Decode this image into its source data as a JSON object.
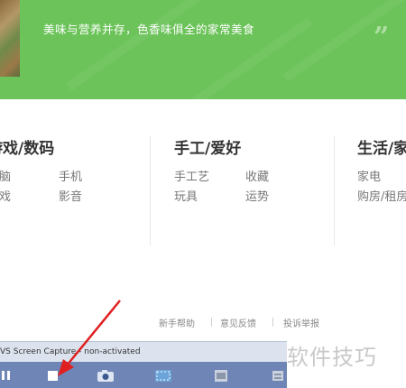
{
  "banner": {
    "slogan": "美味与营养并存，色香味俱全的家常美食",
    "quote_open": "“",
    "quote_close": "”"
  },
  "categories": [
    {
      "title": "游戏/数码",
      "links": [
        "电脑",
        "手机",
        "游戏",
        "影音"
      ]
    },
    {
      "title": "手工/爱好",
      "links": [
        "手工艺",
        "收藏",
        "玩具",
        "运势"
      ]
    },
    {
      "title": "生活/家",
      "links": [
        "家电",
        "",
        "购房/租房",
        ""
      ]
    }
  ],
  "footer": {
    "links": [
      "新手帮助",
      "意见反馈",
      "投诉举报"
    ]
  },
  "capture_bar": {
    "title": "VS Screen Capture - non-activated",
    "buttons": [
      "pause-icon",
      "stop-icon",
      "camera-icon",
      "region-icon",
      "film-icon",
      "settings-icon"
    ]
  },
  "watermark": "软件技巧",
  "colors": {
    "banner_green": "#6cc35a",
    "capture_bar_blue": "#6e85b5",
    "arrow_red": "#e02020"
  }
}
